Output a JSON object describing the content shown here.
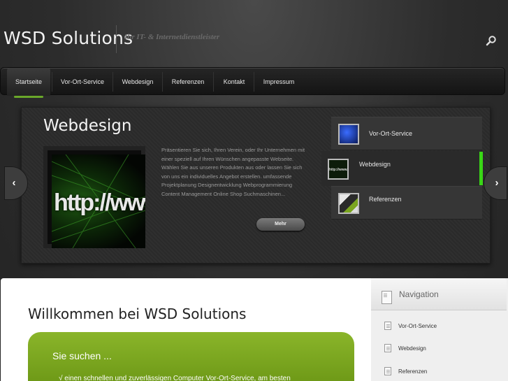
{
  "header": {
    "logo": "WSD Solutions",
    "tagline": "Ihr IT- & Internetdienstleister",
    "search_icon": "search-icon"
  },
  "nav": {
    "items": [
      {
        "label": "Startseite",
        "active": true
      },
      {
        "label": "Vor-Ort-Service",
        "active": false
      },
      {
        "label": "Webdesign",
        "active": false
      },
      {
        "label": "Referenzen",
        "active": false
      },
      {
        "label": "Kontakt",
        "active": false
      },
      {
        "label": "Impressum",
        "active": false
      }
    ]
  },
  "slider": {
    "title": "Webdesign",
    "image_text": "http://www.",
    "text": "Präsentieren Sie sich, Ihren Verein, oder Ihr Unternehmen mit einer speziell auf Ihren Wünschen angepasste Webseite. Wählen Sie aus unseren Produkten aus oder lassen Sie sich von uns ein individuelles Angebot erstellen. umfassende Projektplanung Designentwicklung Webprogrammierung Content Management Online Shop Suchmaschinen...",
    "more_label": "Mehr",
    "prev_icon": "arrow-left-icon",
    "next_icon": "arrow-right-icon",
    "thumbs": [
      {
        "label": "Vor-Ort-Service",
        "thumb_text": ""
      },
      {
        "label": "Webdesign",
        "thumb_text": "http://www."
      },
      {
        "label": "Referenzen",
        "thumb_text": ""
      }
    ],
    "active_color": "#39d616"
  },
  "main": {
    "welcome": "Willkommen bei WSD Solutions",
    "box_title": "Sie suchen ...",
    "box_line": "√ einen schnellen und zuverlässigen Computer Vor-Ort-Service, am besten",
    "accent": "#7aa51f"
  },
  "sidebar": {
    "title": "Navigation",
    "items": [
      {
        "label": "Vor-Ort-Service"
      },
      {
        "label": "Webdesign"
      },
      {
        "label": "Referenzen"
      }
    ]
  }
}
